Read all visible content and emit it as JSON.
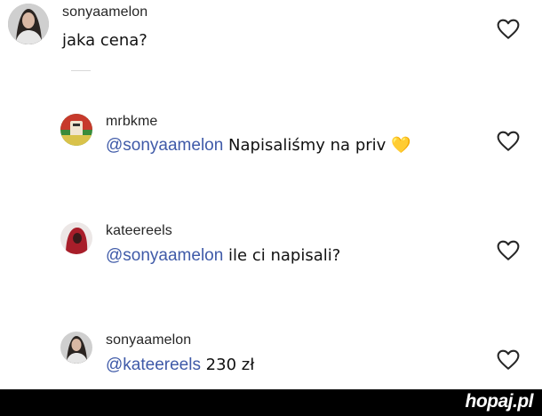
{
  "comments": [
    {
      "username": "sonyaamelon",
      "mention": "",
      "text": "jaka cena?",
      "avatar": "avatar-woman-dark-hair",
      "like_icon": "heart-outline-icon"
    },
    {
      "username": "mrbkme",
      "mention": "@sonyaamelon",
      "text": " Napisaliśmy na priv ",
      "emoji": "💛",
      "avatar": "avatar-red-green-logo",
      "like_icon": "heart-outline-icon"
    },
    {
      "username": "kateereels",
      "mention": "@sonyaamelon",
      "text": " ile ci napisali?",
      "avatar": "avatar-red-hood",
      "like_icon": "heart-outline-icon"
    },
    {
      "username": "sonyaamelon",
      "mention": "@kateereels",
      "text": " 230 zł",
      "avatar": "avatar-woman-dark-hair",
      "like_icon": "heart-outline-icon"
    }
  ],
  "footer": {
    "brand": "hopaj.pl"
  },
  "colors": {
    "mention": "#3f5aa8",
    "text": "#111111",
    "username": "#262626",
    "footer_bg": "#000000"
  }
}
